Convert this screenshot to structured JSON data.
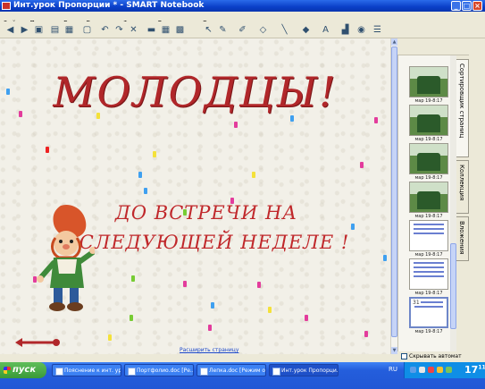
{
  "window": {
    "title": "Инт.урок Пропорции * - SMART Notebook",
    "controls": [
      "_",
      "□",
      "×"
    ]
  },
  "menu": [
    "Файл",
    "Правка",
    "Вид",
    "Вставка",
    "Формат",
    "Рисование",
    "Справка"
  ],
  "toolbar_icons": [
    "back-icon",
    "forward-icon",
    "add-page-icon",
    "open-icon",
    "save-icon",
    "paste-icon",
    "undo-icon",
    "redo-icon",
    "delete-icon",
    "screen-shade-icon",
    "table-icon",
    "display-icon",
    "select-icon",
    "pen-icon",
    "creative-pen-icon",
    "eraser-icon",
    "line-icon",
    "shape-icon",
    "text-icon",
    "fill-icon",
    "properties-icon",
    "more-icon"
  ],
  "slide": {
    "heading": "МОЛОДЦЫ!",
    "line1": "ДО ВСТРЕЧИ НА",
    "line2": "СЛЕДУЮЩЕЙ НЕДЕЛЕ !",
    "expand_link": "Расширить страницу"
  },
  "pages": [
    {
      "date": "мар 19-8:17"
    },
    {
      "date": "мар 19-8:17"
    },
    {
      "date": "мар 19-8:17"
    },
    {
      "date": "мар 19-8:17"
    },
    {
      "date": "мар 19-8:17"
    },
    {
      "date": "мар 19-8:17"
    },
    {
      "number": "31",
      "date": "мар 19-8:17"
    }
  ],
  "side_tabs": [
    "Сортировщик страниц",
    "Коллекция",
    "Вложения"
  ],
  "autohide_label": "Скрывать автомат",
  "taskbar": {
    "start": "пуск",
    "tasks": [
      "Пояснение к инт. ур...",
      "Портфолио.doc [Ре...",
      "Лепка.doc [Режим о...",
      "Инт.урок Пропорци..."
    ],
    "language": "RU",
    "clock_hour": "17",
    "clock_min": "11"
  },
  "colors": {
    "heading": "#b1272a",
    "titlebar": "#0a3fc8",
    "taskbar": "#245edc",
    "start": "#3a9a37"
  }
}
